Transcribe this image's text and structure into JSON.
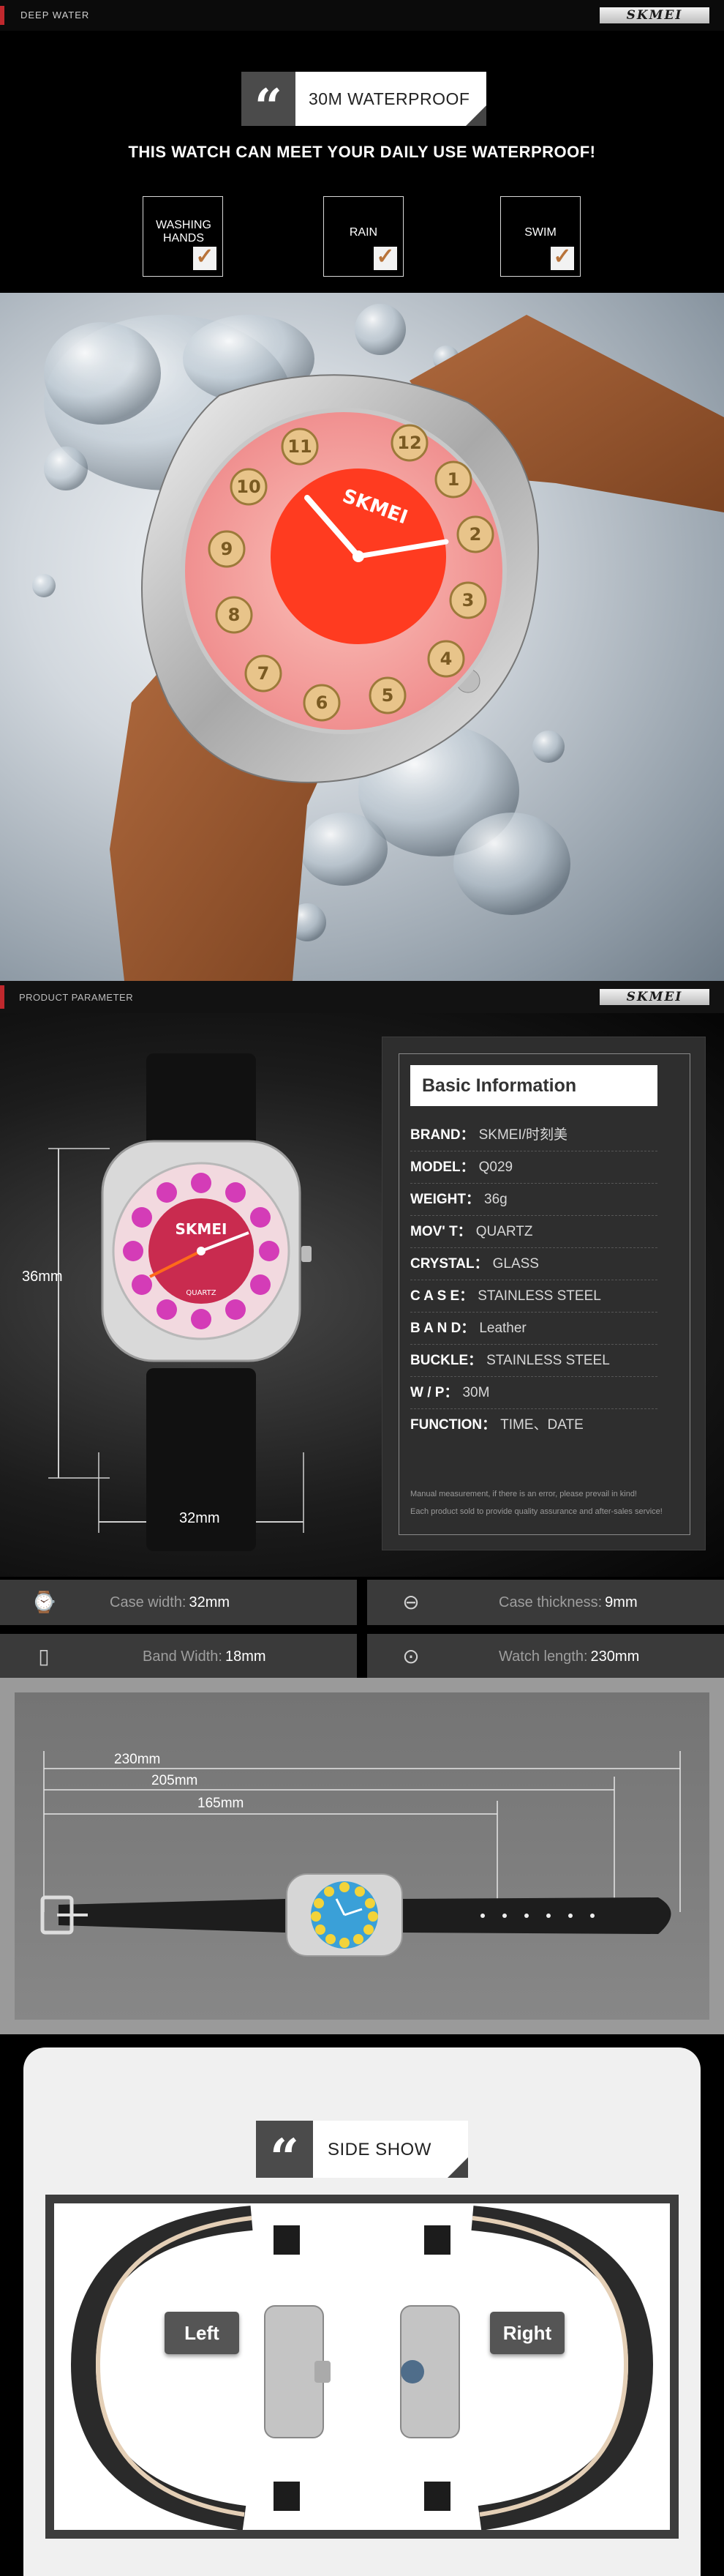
{
  "header": {
    "section_label": "DEEP WATER",
    "brand": "SKMEI"
  },
  "waterproof": {
    "tag": "30M WATERPROOF",
    "subtitle": "THIS WATCH CAN MEET YOUR DAILY USE WATERPROOF!",
    "features": [
      {
        "label": "WASHING HANDS"
      },
      {
        "label": "RAIN"
      },
      {
        "label": "SWIM"
      }
    ]
  },
  "hero_watch": {
    "dial_brand": "SKMEI",
    "numbers": [
      "12",
      "1",
      "2",
      "3",
      "4",
      "5",
      "6",
      "7",
      "8",
      "9",
      "10",
      "11"
    ],
    "colors": {
      "strap": "#9a5a33",
      "dial_outer": "#f4a2a2",
      "dial_center": "#ff3b20",
      "case": "#c8c8c8"
    }
  },
  "product_parameter": {
    "section_label": "PRODUCT PARAMETER",
    "brand": "SKMEI",
    "dim_height": "36mm",
    "dim_width": "32mm",
    "watch": {
      "dial_brand": "SKMEI",
      "dial_movement": "QUARTZ",
      "colors": {
        "strap": "#141414",
        "dial_outer": "#f2d9df",
        "dial_center": "#c92b4f",
        "numbers": "#d43cb7"
      }
    }
  },
  "basic_info": {
    "title": "Basic Information",
    "rows": [
      {
        "key": "BRAND：",
        "value": "SKMEI/时刻美"
      },
      {
        "key": "MODEL：",
        "value": "Q029"
      },
      {
        "key": "WEIGHT：",
        "value": "36g"
      },
      {
        "key": "MOV' T：",
        "value": "QUARTZ"
      },
      {
        "key": "CRYSTAL：",
        "value": "GLASS"
      },
      {
        "key": "C A S E：",
        "value": "STAINLESS STEEL"
      },
      {
        "key": "B A N D：",
        "value": "Leather"
      },
      {
        "key": "BUCKLE：",
        "value": "STAINLESS STEEL"
      },
      {
        "key": "W / P：",
        "value": "30M"
      },
      {
        "key": "FUNCTION：",
        "value": "TIME、DATE"
      }
    ],
    "note_line1": "Manual measurement, if there is an error, please prevail in kind!",
    "note_line2": "Each product sold to provide quality assurance and after-sales service!"
  },
  "measurements": [
    {
      "icon": "case-width-icon",
      "label": "Case width:",
      "value": "32mm"
    },
    {
      "icon": "case-thickness-icon",
      "label": "Case thickness:",
      "value": "9mm"
    },
    {
      "icon": "band-width-icon",
      "label": "Band Width:",
      "value": "18mm"
    },
    {
      "icon": "watch-length-icon",
      "label": "Watch length:",
      "value": "230mm"
    }
  ],
  "strap_lengths": {
    "total": "230mm",
    "mid": "205mm",
    "short": "165mm",
    "dial_colors": {
      "dial": "#3aa0d8",
      "numbers": "#f3d33a"
    }
  },
  "side_show": {
    "tag": "SIDE SHOW",
    "left": "Left",
    "right": "Right"
  }
}
